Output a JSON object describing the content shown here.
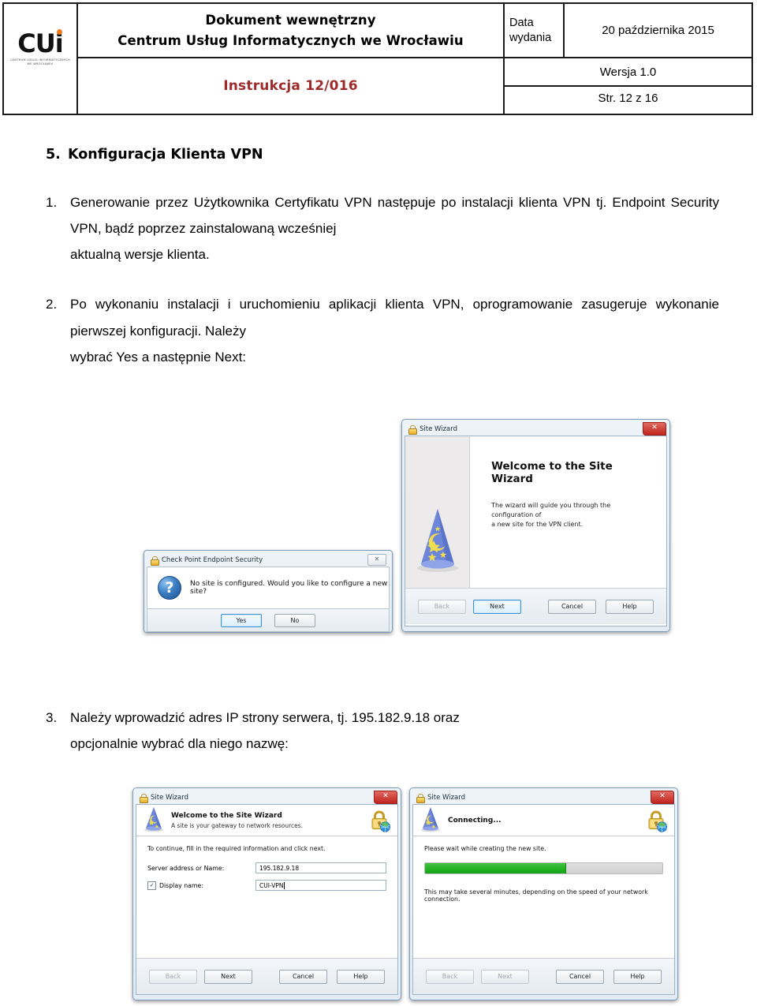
{
  "header": {
    "logo": {
      "mark": "CUi",
      "subtext_line1": "CENTRUM USŁUG INFORMATYCZNYCH",
      "subtext_line2": "WE WROCŁAWIU",
      "dot_color": "#f07a1e"
    },
    "doc_type": "Dokument wewnętrzny",
    "organization": "Centrum Usług Informatycznych we Wrocławiu",
    "instruction": "Instrukcja 12/016",
    "instruction_color": "#9e2a2a",
    "date_label_line1": "Data",
    "date_label_line2": "wydania",
    "date_value": "20 października 2015",
    "version": "Wersja 1.0",
    "page": "Str. 12 z 16"
  },
  "section": {
    "number": "5.",
    "title": "Konfiguracja Klienta VPN"
  },
  "items": [
    {
      "number": "1.",
      "line1": "Generowanie przez Użytkownika Certyfikatu VPN następuje po instalacji",
      "line2": "klienta VPN tj. Endpoint Security VPN, bądź poprzez zainstalowaną wcześniej",
      "line3": "aktualną wersje klienta."
    },
    {
      "number": "2.",
      "line1": "Po wykonaniu instalacji i uruchomieniu aplikacji klienta VPN,",
      "line2": "oprogramowanie zasugeruje wykonanie pierwszej konfiguracji. Należy",
      "line3": "wybrać Yes a następnie Next:"
    },
    {
      "number": "3.",
      "line1": "Należy wprowadzić adres IP strony serwera, tj. 195.182.9.18 oraz",
      "line2": "opcjonalnie wybrać dla niego nazwę:"
    }
  ],
  "screenshots": {
    "checkpoint_dialog": {
      "title": "Check Point Endpoint Security",
      "close_glyph": "✕",
      "message": "No site is configured. Would you like to configure a new site?",
      "question_glyph": "?",
      "yes_label": "Yes",
      "no_label": "No"
    },
    "site_wizard_welcome": {
      "title": "Site Wizard",
      "close_glyph": "✕",
      "heading": "Welcome to the Site Wizard",
      "paragraph_line1": "The wizard will guide you through the configuration of",
      "paragraph_line2": "a new site for the VPN client.",
      "back_label": "Back",
      "next_label": "Next",
      "cancel_label": "Cancel",
      "help_label": "Help"
    },
    "site_wizard_form": {
      "title": "Site Wizard",
      "close_glyph": "✕",
      "banner_title": "Welcome to the Site Wizard",
      "banner_subtitle": "A site is your gateway to network resources.",
      "instruction": "To continue, fill in the required information and click next.",
      "server_label": "Server address or Name:",
      "server_value": "195.182.9.18",
      "display_label": "Display name:",
      "display_value": "CUI-VPN",
      "display_checked_glyph": "✓",
      "back_label": "Back",
      "next_label": "Next",
      "cancel_label": "Cancel",
      "help_label": "Help"
    },
    "site_wizard_connecting": {
      "title": "Site Wizard",
      "close_glyph": "✕",
      "banner_title": "Connecting...",
      "instruction": "Please wait while creating the new site.",
      "progress_percent": 59,
      "note": "This may take several minutes, depending on the speed of your network connection.",
      "back_label": "Back",
      "next_label": "Next",
      "cancel_label": "Cancel",
      "help_label": "Help"
    }
  }
}
